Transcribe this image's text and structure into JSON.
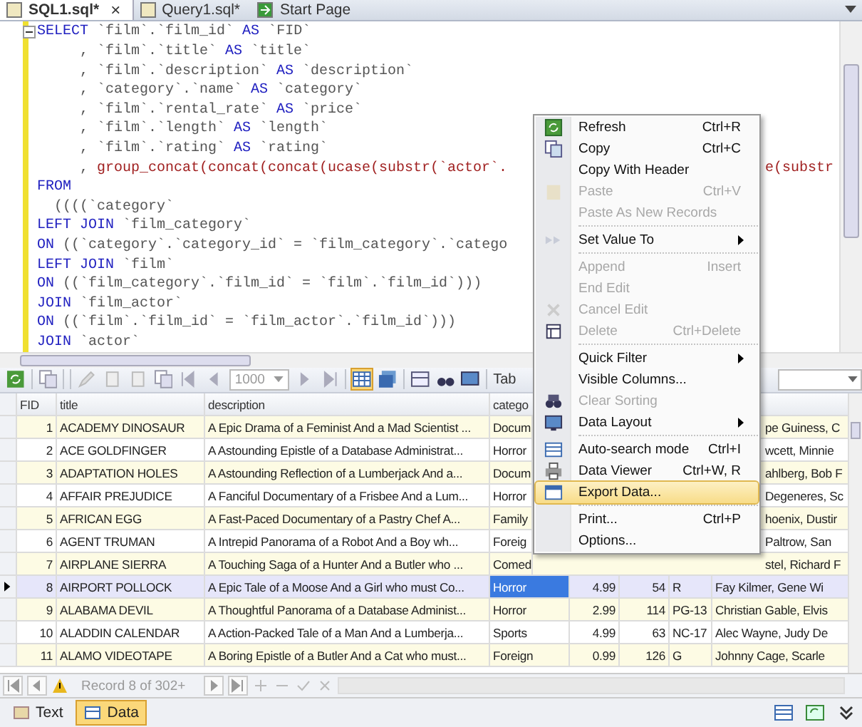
{
  "tabs": [
    {
      "label": "SQL1.sql*",
      "selected": true,
      "close": "×"
    },
    {
      "label": "Query1.sql*",
      "selected": false
    },
    {
      "label": "Start Page",
      "selected": false
    }
  ],
  "editor": {
    "lines": [
      [
        {
          "kind": "kw",
          "text": "SELECT"
        },
        {
          "kind": "id",
          "text": " `film`.`film_id` "
        },
        {
          "kind": "kw",
          "text": "AS"
        },
        {
          "kind": "id",
          "text": " `FID`"
        }
      ],
      [
        {
          "kind": "id",
          "text": "     , `film`.`title` "
        },
        {
          "kind": "kw",
          "text": "AS"
        },
        {
          "kind": "id",
          "text": " `title`"
        }
      ],
      [
        {
          "kind": "id",
          "text": "     , `film`.`description` "
        },
        {
          "kind": "kw",
          "text": "AS"
        },
        {
          "kind": "id",
          "text": " `description`"
        }
      ],
      [
        {
          "kind": "id",
          "text": "     , `category`.`name` "
        },
        {
          "kind": "kw",
          "text": "AS"
        },
        {
          "kind": "id",
          "text": " `category`"
        }
      ],
      [
        {
          "kind": "id",
          "text": "     , `film`.`rental_rate` "
        },
        {
          "kind": "kw",
          "text": "AS"
        },
        {
          "kind": "id",
          "text": " `price`"
        }
      ],
      [
        {
          "kind": "id",
          "text": "     , `film`.`length` "
        },
        {
          "kind": "kw",
          "text": "AS"
        },
        {
          "kind": "id",
          "text": " `length`"
        }
      ],
      [
        {
          "kind": "id",
          "text": "     , `film`.`rating` "
        },
        {
          "kind": "kw",
          "text": "AS"
        },
        {
          "kind": "id",
          "text": " `rating`"
        }
      ],
      [
        {
          "kind": "id",
          "text": "     , "
        },
        {
          "kind": "fn",
          "text": "group_concat(concat(concat(ucase(substr(`actor`."
        }
      ],
      [
        {
          "kind": "kw",
          "text": "FROM"
        }
      ],
      [
        {
          "kind": "id",
          "text": "  ((((`category`"
        }
      ],
      [
        {
          "kind": "kw",
          "text": "LEFT JOIN"
        },
        {
          "kind": "id",
          "text": " `film_category`"
        }
      ],
      [
        {
          "kind": "kw",
          "text": "ON"
        },
        {
          "kind": "id",
          "text": " ((`category`.`category_id` = `film_category`.`catego"
        }
      ],
      [
        {
          "kind": "kw",
          "text": "LEFT JOIN"
        },
        {
          "kind": "id",
          "text": " `film`"
        }
      ],
      [
        {
          "kind": "kw",
          "text": "ON"
        },
        {
          "kind": "id",
          "text": " ((`film_category`.`film_id` = `film`.`film_id`)))"
        }
      ],
      [
        {
          "kind": "kw",
          "text": "JOIN"
        },
        {
          "kind": "id",
          "text": " `film_actor`"
        }
      ],
      [
        {
          "kind": "kw",
          "text": "ON"
        },
        {
          "kind": "id",
          "text": " ((`film`.`film_id` = `film_actor`.`film_id`)))"
        }
      ],
      [
        {
          "kind": "kw",
          "text": "JOIN"
        },
        {
          "kind": "id",
          "text": " `actor`"
        }
      ]
    ],
    "right_fragment": "e(substr"
  },
  "toolbar": {
    "limit": "1000",
    "label": "Tab"
  },
  "grid": {
    "columns": [
      "FID",
      "title",
      "description",
      "catego"
    ],
    "rows": [
      {
        "fid": "1",
        "title": "ACADEMY DINOSAUR",
        "description": "A Epic Drama of a Feminist And a Mad Scientist ...",
        "category": "Docum",
        "actors": "pe Guiness, C",
        "selected": false
      },
      {
        "fid": "2",
        "title": "ACE GOLDFINGER",
        "description": "A Astounding Epistle of a Database Administrat...",
        "category": "Horror",
        "actors": "wcett, Minnie",
        "selected": false
      },
      {
        "fid": "3",
        "title": "ADAPTATION HOLES",
        "description": "A Astounding Reflection of a Lumberjack And a...",
        "category": "Docum",
        "actors": "ahlberg, Bob F",
        "selected": false
      },
      {
        "fid": "4",
        "title": "AFFAIR PREJUDICE",
        "description": "A Fanciful Documentary of a Frisbee And a Lum...",
        "category": "Horror",
        "actors": "Degeneres, Sc",
        "selected": false
      },
      {
        "fid": "5",
        "title": "AFRICAN EGG",
        "description": "A Fast-Paced Documentary of a Pastry Chef A...",
        "category": "Family",
        "actors": "hoenix, Dustir",
        "selected": false
      },
      {
        "fid": "6",
        "title": "AGENT TRUMAN",
        "description": "A Intrepid Panorama of a Robot And a Boy wh...",
        "category": "Foreig",
        "actors": "Paltrow, San",
        "selected": false
      },
      {
        "fid": "7",
        "title": "AIRPLANE SIERRA",
        "description": "A Touching Saga of a Hunter And a Butler who ...",
        "category": "Comed",
        "actors": "stel, Richard F",
        "selected": false
      },
      {
        "fid": "8",
        "title": "AIRPORT POLLOCK",
        "description": "A Epic Tale of a Moose And a Girl who must Co...",
        "category": "Horror",
        "price": "4.99",
        "length": "54",
        "rating": "R",
        "actors": "Fay Kilmer, Gene Wi",
        "selected": true
      },
      {
        "fid": "9",
        "title": "ALABAMA DEVIL",
        "description": "A Thoughtful Panorama of a Database Administ...",
        "category": "Horror",
        "price": "2.99",
        "length": "114",
        "rating": "PG-13",
        "actors": "Christian Gable, Elvis",
        "selected": false
      },
      {
        "fid": "10",
        "title": "ALADDIN CALENDAR",
        "description": "A Action-Packed Tale of a Man And a Lumberja...",
        "category": "Sports",
        "price": "4.99",
        "length": "63",
        "rating": "NC-17",
        "actors": "Alec Wayne, Judy De",
        "selected": false
      },
      {
        "fid": "11",
        "title": "ALAMO VIDEOTAPE",
        "description": "A Boring Epistle of a Butler And a Cat who must...",
        "category": "Foreign",
        "price": "0.99",
        "length": "126",
        "rating": "G",
        "actors": "Johnny Cage, Scarle",
        "selected": false
      }
    ]
  },
  "navigator": {
    "record": "Record 8 of 302+"
  },
  "bottom_tabs": [
    {
      "label": "Text",
      "selected": false
    },
    {
      "label": "Data",
      "selected": true
    }
  ],
  "context_menu": [
    {
      "kind": "item",
      "label": "Refresh",
      "shortcut": "Ctrl+R",
      "disabled": false,
      "selected": false
    },
    {
      "kind": "item",
      "label": "Copy",
      "shortcut": "Ctrl+C",
      "disabled": false,
      "selected": false
    },
    {
      "kind": "item",
      "label": "Copy With Header",
      "disabled": false,
      "selected": false
    },
    {
      "kind": "item",
      "label": "Paste",
      "shortcut": "Ctrl+V",
      "disabled": true,
      "selected": false
    },
    {
      "kind": "item",
      "label": "Paste As New Records",
      "disabled": true,
      "selected": false
    },
    {
      "kind": "separator"
    },
    {
      "kind": "item",
      "label": "Set Value To",
      "submenu": true,
      "disabled": false,
      "selected": false
    },
    {
      "kind": "separator"
    },
    {
      "kind": "item",
      "label": "Append",
      "shortcut": "Insert",
      "disabled": true,
      "selected": false
    },
    {
      "kind": "item",
      "label": "End Edit",
      "disabled": true,
      "selected": false
    },
    {
      "kind": "item",
      "label": "Cancel Edit",
      "disabled": true,
      "selected": false
    },
    {
      "kind": "item",
      "label": "Delete",
      "shortcut": "Ctrl+Delete",
      "disabled": true,
      "selected": false
    },
    {
      "kind": "separator"
    },
    {
      "kind": "item",
      "label": "Quick Filter",
      "submenu": true,
      "disabled": false,
      "selected": false
    },
    {
      "kind": "item",
      "label": "Visible Columns...",
      "disabled": false,
      "selected": false
    },
    {
      "kind": "item",
      "label": "Clear Sorting",
      "disabled": true,
      "selected": false
    },
    {
      "kind": "item",
      "label": "Data Layout",
      "submenu": true,
      "disabled": false,
      "selected": false
    },
    {
      "kind": "separator"
    },
    {
      "kind": "item",
      "label": "Auto-search mode",
      "shortcut": "Ctrl+I",
      "disabled": false,
      "selected": false
    },
    {
      "kind": "item",
      "label": "Data Viewer",
      "shortcut": "Ctrl+W, R",
      "disabled": false,
      "selected": false
    },
    {
      "kind": "item",
      "label": "Export Data...",
      "disabled": false,
      "selected": true
    },
    {
      "kind": "separator"
    },
    {
      "kind": "item",
      "label": "Print...",
      "shortcut": "Ctrl+P",
      "disabled": false,
      "selected": false
    },
    {
      "kind": "item",
      "label": "Options...",
      "disabled": false,
      "selected": false
    }
  ]
}
